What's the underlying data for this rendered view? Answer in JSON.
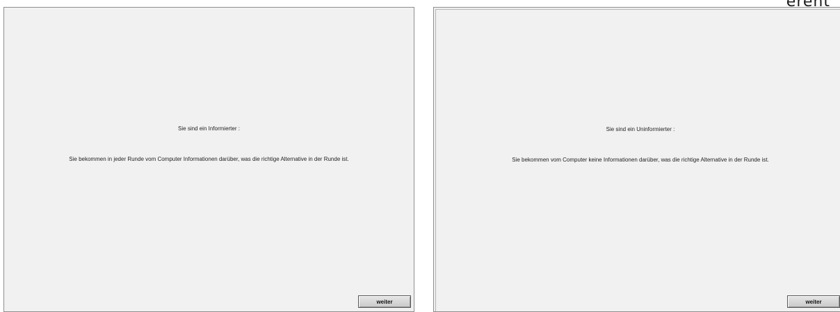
{
  "left_screen": {
    "role_text": "Sie sind ein Informierter :",
    "info_text": "Sie bekommen in jeder Runde vom Computer Informationen darüber, was die richtige Alternative in der Runde ist.",
    "next_button_label": "weiter"
  },
  "right_screen": {
    "role_text": "Sie sind ein Uninformierter :",
    "info_text": "Sie bekommen vom Computer keine Informationen darüber, was die richtige Alternative in der Runde ist.",
    "next_button_label": "weiter"
  },
  "corner_text": "erent"
}
